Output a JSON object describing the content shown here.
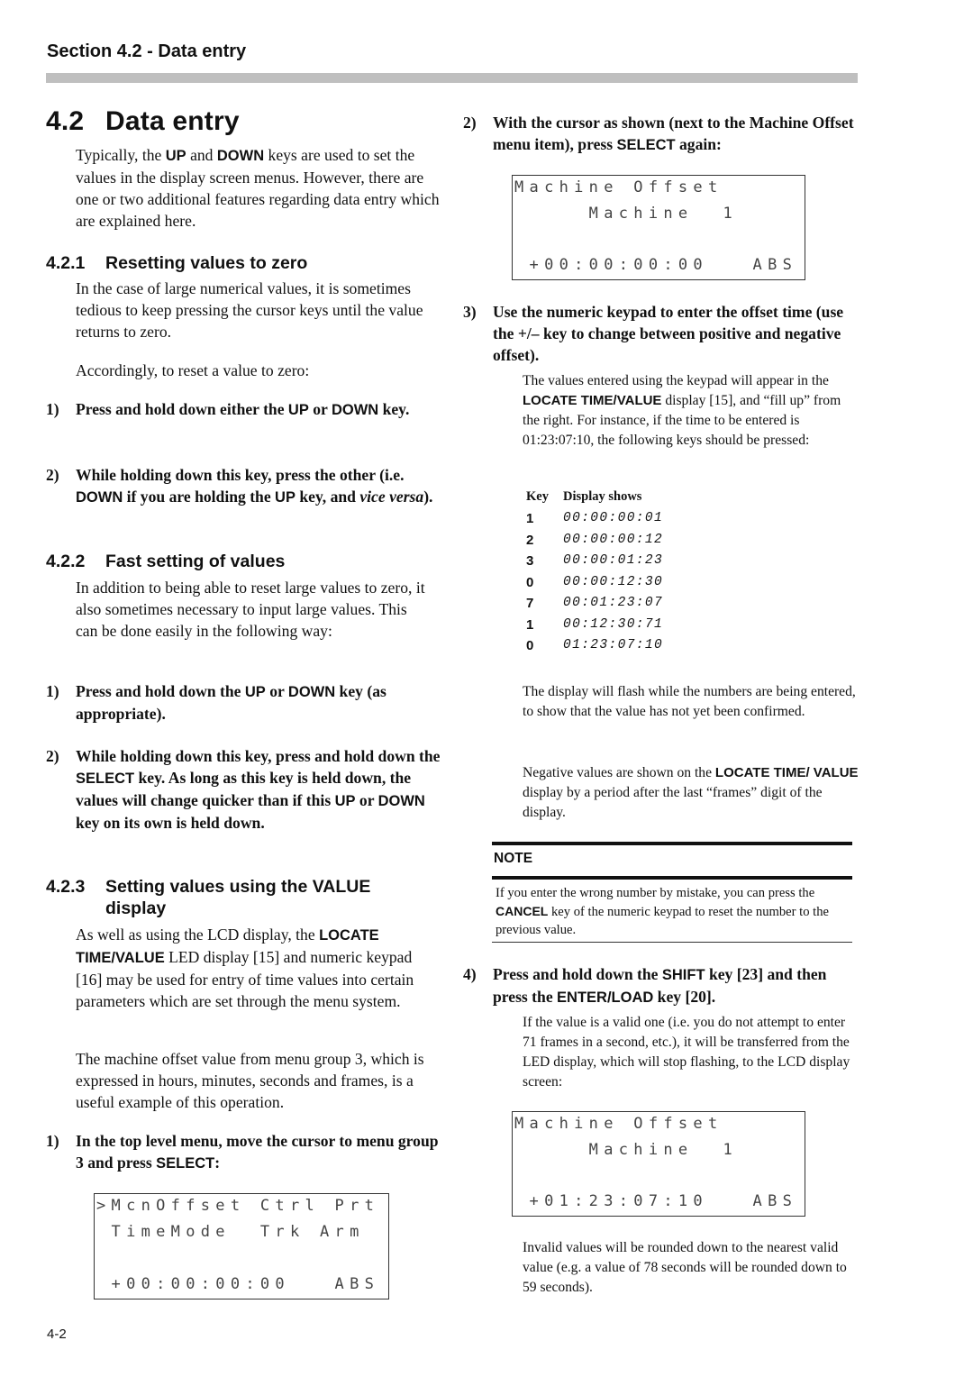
{
  "running_head": "Section 4.2 - Data entry",
  "section": {
    "number": "4.2",
    "title": "Data entry",
    "intro": [
      "Typically, the ",
      "UP",
      " and ",
      "DOWN",
      " keys are used to set the values in the display screen menus. However, there are one or two additional features regarding data entry which are explained here."
    ]
  },
  "sub_421": {
    "number": "4.2.1",
    "title": "Resetting values to zero",
    "para1": "In the case of large numerical values, it is sometimes tedious to keep pressing the cursor keys until the value returns to zero.",
    "para2": "Accordingly, to reset a value to zero:",
    "steps": [
      {
        "n": "1)",
        "parts": [
          "Press and hold down either the ",
          "UP",
          " or ",
          "DOWN",
          " key."
        ]
      },
      {
        "n": "2)",
        "parts": [
          "While holding down this key, press the other (i.e. ",
          "DOWN",
          " if you are holding the ",
          "UP",
          " key, and ",
          "vice versa",
          ")."
        ]
      }
    ]
  },
  "sub_422": {
    "number": "4.2.2",
    "title": "Fast setting of values",
    "para1": "In addition to being able to reset large values to zero, it also sometimes necessary to input large values. This can be done easily in the following way:",
    "steps": [
      {
        "n": "1)",
        "parts": [
          "Press and hold down the ",
          "UP",
          " or ",
          "DOWN",
          " key (as appropriate)."
        ]
      },
      {
        "n": "2)",
        "parts": [
          "While holding down this key, press and hold down the ",
          "SELECT",
          " key. As long as this key is held down, the values will change quicker than if this ",
          "UP",
          " or ",
          "DOWN",
          " key on its own is held down."
        ]
      }
    ]
  },
  "sub_423": {
    "number": "4.2.3",
    "title_line1": "Setting values using the VALUE",
    "title_line2": "display",
    "para1": [
      "As well as using the LCD display, the ",
      "LOCATE TIME/VALUE",
      " LED display [15] and numeric keypad [16] may be used for entry of time values into certain parameters which are set through the menu system."
    ],
    "para2": "The machine offset value from menu group 3, which is expressed in hours, minutes, seconds and frames, is a useful example of this operation.",
    "step1": {
      "n": "1)",
      "parts": [
        "In the top level menu, move the cursor to menu group 3 and press ",
        "SELECT",
        ":"
      ]
    },
    "lcd1": {
      "rows": [
        ">McnOffset Ctrl Prt",
        " TimeMode  Trk Arm",
        "",
        " +00:00:00:00   ABS"
      ]
    }
  },
  "right": {
    "step2": {
      "n": "2)",
      "parts": [
        "With the cursor as shown (next to the Machine Offset menu item), press ",
        "SELECT",
        " again:"
      ]
    },
    "lcd2": {
      "rows": [
        "Machine Offset",
        "     Machine  1",
        "",
        " +00:00:00:00   ABS"
      ]
    },
    "step3": {
      "n": "3)",
      "text": "Use the numeric keypad to enter the offset time (use the +/– key to change between positive and negative offset)."
    },
    "step3_para": [
      "The values entered using the keypad will appear in the ",
      "LOCATE TIME/VALUE",
      " display [15], and “fill up” from the right. For instance, if the time to be entered is 01:23:07:10, the following keys should be pressed:"
    ],
    "key_table": {
      "headers": [
        "Key",
        "Display shows"
      ],
      "rows": [
        {
          "key": "1",
          "display": "00:00:00:01"
        },
        {
          "key": "2",
          "display": "00:00:00:12"
        },
        {
          "key": "3",
          "display": "00:00:01:23"
        },
        {
          "key": "0",
          "display": "00:00:12:30"
        },
        {
          "key": "7",
          "display": "00:01:23:07"
        },
        {
          "key": "1",
          "display": "00:12:30:71"
        },
        {
          "key": "0",
          "display": "01:23:07:10"
        }
      ]
    },
    "flash_para": "The display will flash while the numbers are being entered, to show that the value has not yet been confirmed.",
    "negative_para": [
      "Negative values are shown on the ",
      "LOCATE TIME/ VALUE",
      " display by a period after the last “frames” digit of the display."
    ],
    "note": {
      "label": "NOTE",
      "parts": [
        "If you enter the wrong number by mistake, you can press the ",
        "CANCEL",
        " key of the numeric keypad to reset the number to the previous value."
      ]
    },
    "step4": {
      "n": "4)",
      "parts": [
        "Press and hold down the ",
        "SHIFT",
        " key [23] and then press the ",
        "ENTER/LOAD",
        " key [20]."
      ]
    },
    "step4_para": "If the value is a valid one (i.e. you do not attempt to enter 71 frames in a second, etc.), it will be transferred from the LED display, which will stop flashing, to the LCD display screen:",
    "lcd3": {
      "rows": [
        "Machine Offset",
        "     Machine  1",
        "",
        " +01:23:07:10   ABS"
      ]
    },
    "invalid_para": "Invalid values will be rounded down to the nearest valid value (e.g. a value of 78 seconds will be rounded down to 59 seconds)."
  },
  "folio": "4-2"
}
